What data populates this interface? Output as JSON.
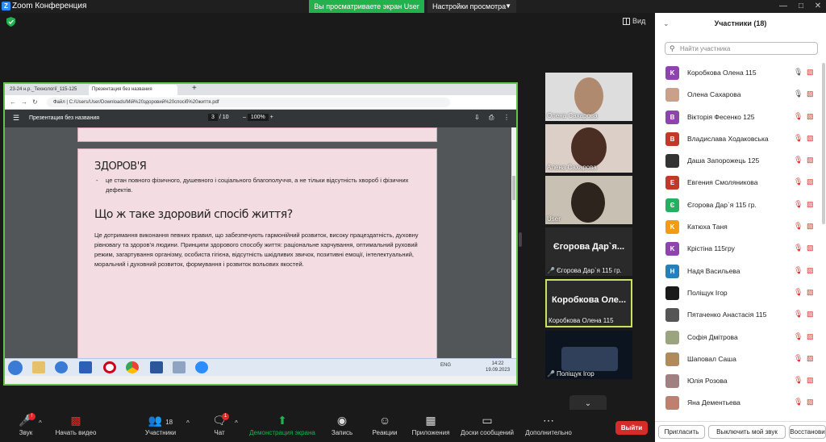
{
  "app": {
    "title": "Zoom Конференция",
    "logo_letter": "Z"
  },
  "share_banner": {
    "text": "Вы просматриваете экран User",
    "settings": "Настройки просмотра"
  },
  "view_label": "Вид",
  "browser": {
    "tab1": "23-24 н.р._Технології_115-125",
    "tab2": "Презентация без названия",
    "url_prefix": "Файл",
    "url": "C:/Users/User/Downloads/Мій%20здоровий%20спосіб%20життя.pdf",
    "pdf_title": "Презентация без названия",
    "page_current": "3",
    "page_total": "/ 10",
    "zoom": "100%"
  },
  "slide": {
    "heading1": "ЗДОРОВ'Я",
    "bullet": "це стан повного фізичного, душевного і соціального благополуччя, а не тільки відсутність хвороб і фізичних дефектів.",
    "heading2": "Що ж таке здоровий спосіб життя?",
    "paragraph": "Це дотримання виконання певних правил, що забезпечують гармонійний розвиток, високу працездатність, духовну рівновагу та здоров'я людини. Принципи здорового способу життя: раціональне харчування, оптимальний руховий режим, загартування організму, особиста гігієна, відсутність шкідливих звичок, позитивні емоції, інтелектуальний, моральний і духовний розвиток,  формування  і розвиток вольових якостей."
  },
  "taskbar": {
    "tray": "ENG",
    "time": "14:22",
    "date": "19.09.2023"
  },
  "gallery": [
    {
      "name": "Олена Сахарова",
      "type": "video"
    },
    {
      "name": "Алена Сахарова",
      "type": "video"
    },
    {
      "name": "User",
      "type": "video"
    },
    {
      "name": "Єгорова Дар`я 115 гр.",
      "big": "Єгорова Дар`я...",
      "type": "name",
      "muted": true
    },
    {
      "name": "Коробкова Олена 115",
      "big": "Коробкова  Оле...",
      "type": "name",
      "active": true
    },
    {
      "name": "Поліщук Ігор",
      "type": "video",
      "muted": true
    }
  ],
  "participants": {
    "header": "Участники (18)",
    "search_placeholder": "Найти участника",
    "list": [
      {
        "name": "Коробкова Олена 115",
        "initial": "K",
        "color": "#8e44ad",
        "mic": "on"
      },
      {
        "name": "Олена Сахарова",
        "initial": "",
        "color": "#c9a08a",
        "mic": "on"
      },
      {
        "name": "Вікторія Фесенко 125",
        "initial": "B",
        "color": "#8e44ad",
        "mic": "off"
      },
      {
        "name": "Владислава Ходаковська",
        "initial": "B",
        "color": "#c0392b",
        "mic": "off"
      },
      {
        "name": "Даша Запорожець 125",
        "initial": "",
        "color": "#333333",
        "mic": "off"
      },
      {
        "name": "Евгения Смоляникова",
        "initial": "E",
        "color": "#c0392b",
        "mic": "off"
      },
      {
        "name": "Єгорова Дар`я 115 гр.",
        "initial": "Є",
        "color": "#27ae60",
        "mic": "off"
      },
      {
        "name": "Катюха Таня",
        "initial": "K",
        "color": "#f39c12",
        "mic": "off"
      },
      {
        "name": "Крістіна 115гру",
        "initial": "K",
        "color": "#8e44ad",
        "mic": "off"
      },
      {
        "name": "Надя Васильева",
        "initial": "H",
        "color": "#2980b9",
        "mic": "off"
      },
      {
        "name": "Поліщук Ігор",
        "initial": "",
        "color": "#1a1a1a",
        "mic": "off"
      },
      {
        "name": "Пятаченко Анастасія 115",
        "initial": "",
        "color": "#555555",
        "mic": "off"
      },
      {
        "name": "Софія Дмітрова",
        "initial": "",
        "color": "#9aa580",
        "mic": "off"
      },
      {
        "name": "Шаповал Саша",
        "initial": "",
        "color": "#b08a5a",
        "mic": "off"
      },
      {
        "name": "Юлія Розова",
        "initial": "",
        "color": "#a08080",
        "mic": "off"
      },
      {
        "name": "Яна Дементьева",
        "initial": "",
        "color": "#c08070",
        "mic": "off"
      }
    ],
    "invite": "Пригласить",
    "mute_mine": "Выключить мой звук",
    "restore": "Восстанови"
  },
  "toolbar": {
    "audio": "Звук",
    "video": "Начать видео",
    "participants": "Участники",
    "participants_count": "18",
    "chat": "Чат",
    "chat_badge": "1",
    "share": "Демонстрация экрана",
    "record": "Запись",
    "reactions": "Реакции",
    "apps": "Приложения",
    "whiteboard": "Доски сообщений",
    "more": "Дополнительно",
    "leave": "Выйти",
    "audio_badge": "!"
  },
  "colors": {
    "share_border": "#60c34a",
    "share_banner": "#22b14c",
    "leave": "#d42b2b",
    "active_tile": "#c9e265"
  }
}
